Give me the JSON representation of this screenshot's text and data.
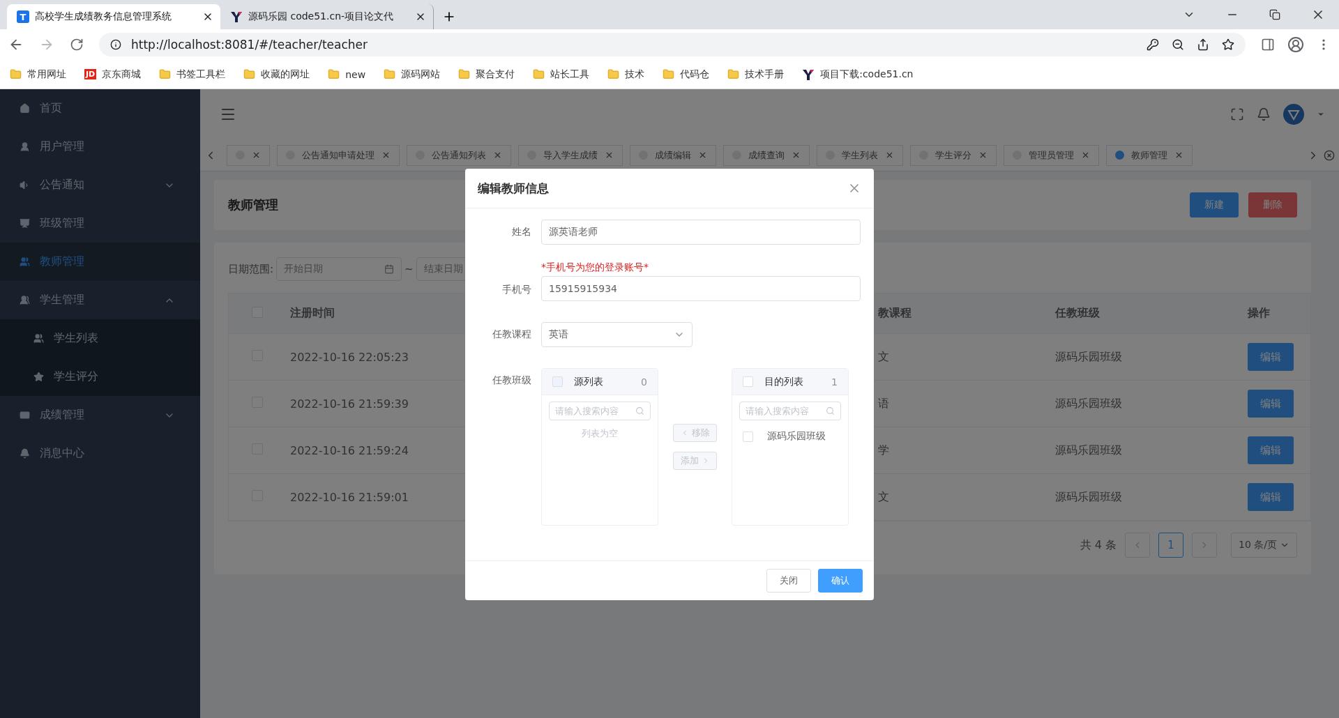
{
  "browser": {
    "tabs": [
      {
        "title": "高校学生成绩教务信息管理系统",
        "selected": true,
        "icon": {
          "kind": "letter",
          "text": "T"
        }
      },
      {
        "title": "源码乐园 code51.cn-项目论文代",
        "selected": false,
        "icon": {
          "kind": "logo"
        }
      }
    ],
    "address": "http://localhost:8081/#/teacher/teacher",
    "bookmarks": [
      {
        "label": "常用网址",
        "kind": "folder"
      },
      {
        "label": "京东商城",
        "kind": "badge",
        "badge": "JD"
      },
      {
        "label": "书签工具栏",
        "kind": "folder"
      },
      {
        "label": "收藏的网址",
        "kind": "folder"
      },
      {
        "label": "new",
        "kind": "folder"
      },
      {
        "label": "源码网站",
        "kind": "folder"
      },
      {
        "label": "聚合支付",
        "kind": "folder"
      },
      {
        "label": "站长工具",
        "kind": "folder"
      },
      {
        "label": "技术",
        "kind": "folder"
      },
      {
        "label": "代码仓",
        "kind": "folder"
      },
      {
        "label": "技术手册",
        "kind": "folder"
      },
      {
        "label": "项目下载:code51.cn",
        "kind": "logo"
      }
    ]
  },
  "sidebar": {
    "items": [
      {
        "label": "首页",
        "selected": false
      },
      {
        "label": "用户管理",
        "selected": false
      },
      {
        "label": "公告通知",
        "selected": false,
        "expanded": false
      },
      {
        "label": "班级管理",
        "selected": false
      },
      {
        "label": "教师管理",
        "selected": true
      },
      {
        "label": "学生管理",
        "selected": false,
        "expanded": true,
        "children": [
          {
            "label": "学生列表",
            "selected": false
          },
          {
            "label": "学生评分",
            "selected": false
          }
        ]
      },
      {
        "label": "成绩管理",
        "selected": false,
        "expanded": false
      },
      {
        "label": "消息中心",
        "selected": false
      }
    ]
  },
  "tags": [
    {
      "selected": false
    },
    {
      "label": "公告通知申请处理",
      "selected": false
    },
    {
      "label": "公告通知列表",
      "selected": false
    },
    {
      "label": "导入学生成绩",
      "selected": false
    },
    {
      "label": "成绩编辑",
      "selected": false
    },
    {
      "label": "成绩查询",
      "selected": false
    },
    {
      "label": "学生列表",
      "selected": false
    },
    {
      "label": "学生评分",
      "selected": false
    },
    {
      "label": "管理员管理",
      "selected": false
    },
    {
      "label": "教师管理",
      "selected": true
    }
  ],
  "page": {
    "title": "教师管理",
    "buttons": [
      {
        "label": "新建",
        "kind": "primary"
      },
      {
        "label": "删除",
        "kind": "danger"
      }
    ],
    "filter": {
      "label": "日期范围:",
      "start_placeholder": "开始日期",
      "separator": "~",
      "end_placeholder": "结束日期"
    },
    "table": {
      "all_checked": false,
      "columns": [
        "注册时间",
        "教课程",
        "任教班级",
        "操作"
      ],
      "rows": [
        {
          "checked": false,
          "time": "2022-10-16 22:05:23",
          "course": "文",
          "class": "源码乐园班级",
          "action": "编辑"
        },
        {
          "checked": false,
          "time": "2022-10-16 21:59:39",
          "course": "语",
          "class": "源码乐园班级",
          "action": "编辑"
        },
        {
          "checked": false,
          "time": "2022-10-16 21:59:24",
          "course": "学",
          "class": "源码乐园班级",
          "action": "编辑"
        },
        {
          "checked": false,
          "time": "2022-10-16 21:59:01",
          "course": "文",
          "class": "源码乐园班级",
          "action": "编辑"
        }
      ]
    },
    "pagination": {
      "total": "共 4 条",
      "pages": [
        {
          "label": "1",
          "selected": true
        }
      ],
      "page_size": "10 条/页"
    }
  },
  "dialog": {
    "title": "编辑教师信息",
    "name": {
      "label": "姓名",
      "value": "源英语老师"
    },
    "phone": {
      "hint": "*手机号为您的登录账号*",
      "label": "手机号",
      "value": "15915915934"
    },
    "course": {
      "label": "任教课程",
      "value": "英语"
    },
    "classes": {
      "label": "任教班级",
      "source": {
        "title": "源列表",
        "count": "0",
        "checked": false,
        "placeholder": "请输入搜索内容",
        "empty": "列表为空"
      },
      "target": {
        "title": "目的列表",
        "count": "1",
        "checked": false,
        "placeholder": "请输入搜索内容",
        "items": [
          {
            "label": "源码乐园班级",
            "checked": false
          }
        ]
      },
      "remove": {
        "label": "移除",
        "disabled": true
      },
      "add": {
        "label": "添加",
        "disabled": true
      }
    },
    "buttons": [
      {
        "label": "关闭",
        "kind": "default"
      },
      {
        "label": "确认",
        "kind": "primary"
      }
    ]
  }
}
